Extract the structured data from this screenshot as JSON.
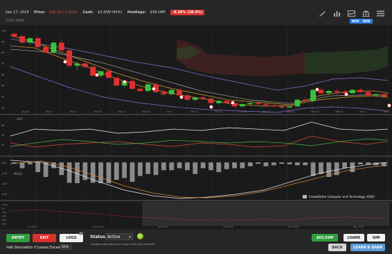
{
  "header": {
    "date": "Dec 17, 2019",
    "price_label": "Price:",
    "price_value": "$40.39 (-2.15%)",
    "cash_label": "Cash:",
    "cash_value": "$3.45M (44%)",
    "holdings_label": "Holdings:",
    "holdings_value": "$39.18M",
    "change_badge": "-8.58% (38.4%)",
    "mode": "STOCK MODE",
    "new_badge": "NEW"
  },
  "toolbar_icons": [
    "draw-tool-icon",
    "chart-type-icon",
    "indicators-icon",
    "bank-icon",
    "menu-icon"
  ],
  "colors": {
    "up": "#3cbf3c",
    "down": "#e03030",
    "panel": "#1a1a1a",
    "grid": "#2c2c2c",
    "accent": "#2c7be5"
  },
  "chart_data": {
    "type": "candlestick",
    "price_axis": [
      "100",
      "90",
      "80",
      "70",
      "60",
      "50",
      "40",
      "30"
    ],
    "x_labels": [
      "Aug 26",
      "Sep 3",
      "Sep 9",
      "Sep 16",
      "Sep 23",
      "Sep 30",
      "Oct 7",
      "Oct 14",
      "Oct 21",
      "Oct 28",
      "Nov 4",
      "Nov 11",
      "Nov 18",
      "Nov 25",
      "Dec 2",
      "Dec 9"
    ],
    "candles": [
      [
        97,
        98,
        93,
        95
      ],
      [
        95,
        96,
        88,
        89
      ],
      [
        89,
        94,
        87,
        93
      ],
      [
        93,
        95,
        84,
        85
      ],
      [
        85,
        87,
        79,
        80
      ],
      [
        80,
        90,
        79,
        89
      ],
      [
        89,
        92,
        80,
        82
      ],
      [
        82,
        83,
        66,
        68
      ],
      [
        68,
        72,
        64,
        70
      ],
      [
        70,
        73,
        66,
        67
      ],
      [
        67,
        68,
        58,
        59
      ],
      [
        59,
        64,
        57,
        63
      ],
      [
        63,
        65,
        56,
        57
      ],
      [
        57,
        58,
        49,
        50
      ],
      [
        50,
        55,
        48,
        54
      ],
      [
        54,
        57,
        46,
        47
      ],
      [
        47,
        49,
        44,
        45
      ],
      [
        45,
        52,
        44,
        51
      ],
      [
        51,
        53,
        43,
        44
      ],
      [
        44,
        46,
        40,
        42
      ],
      [
        42,
        47,
        41,
        46
      ],
      [
        46,
        48,
        40,
        41
      ],
      [
        41,
        42,
        36,
        37
      ],
      [
        37,
        40,
        35,
        39
      ],
      [
        39,
        42,
        37,
        38
      ],
      [
        38,
        39,
        33,
        34
      ],
      [
        34,
        37,
        32,
        36
      ],
      [
        36,
        38,
        33,
        34
      ],
      [
        34,
        35,
        30,
        31
      ],
      [
        31,
        34,
        30,
        33
      ],
      [
        33,
        35,
        31,
        34
      ],
      [
        34,
        36,
        32,
        33
      ],
      [
        33,
        35,
        31,
        32
      ],
      [
        32,
        34,
        30,
        31
      ],
      [
        31,
        33,
        29,
        30
      ],
      [
        30,
        31,
        29,
        31
      ],
      [
        31,
        38,
        30,
        37
      ],
      [
        37,
        40,
        35,
        36
      ],
      [
        36,
        47,
        35,
        46
      ],
      [
        46,
        48,
        42,
        43
      ],
      [
        43,
        46,
        41,
        45
      ],
      [
        45,
        47,
        42,
        44
      ],
      [
        44,
        46,
        41,
        43
      ],
      [
        43,
        47,
        42,
        46
      ],
      [
        46,
        48,
        43,
        44
      ],
      [
        44,
        46,
        40,
        41
      ],
      [
        41,
        43,
        39,
        42
      ],
      [
        42,
        43,
        38,
        40
      ]
    ],
    "oscillator_axis": [
      "60",
      "40",
      "20"
    ],
    "oscillator_label": "ADX",
    "macd_axis": [
      "0.00",
      "-2.00",
      "-4.00",
      "-6.00"
    ],
    "macd_label": "MACD",
    "overview_axis": [
      "+20%",
      "0%",
      "-20%",
      "-40%",
      "-60%",
      "-80%"
    ],
    "overview_labels": [
      "Jul 2019",
      "Aug 2019",
      "Sep 2019",
      "Oct 2019",
      "Nov 2019",
      "Dec 2019"
    ],
    "legend": "CrowdStrike Computer and Technology (USD)"
  },
  "controls": {
    "entry": "ENTRY",
    "exit": "EXIT",
    "logs": "LOGS",
    "logs_count": "42",
    "status_label": "Status:",
    "status_value": "Active",
    "engage_text": "Engage automated logic in buy (entry) and sell (exit)",
    "halt_label": "Halt Simulation if Losses Exceed",
    "halt_value": "50%",
    "cash_button": "$63.53M",
    "loans_button": "LOANS",
    "sim_button": "SIM",
    "back_button": "BACK",
    "learn_button": "LEARN & EARN"
  }
}
